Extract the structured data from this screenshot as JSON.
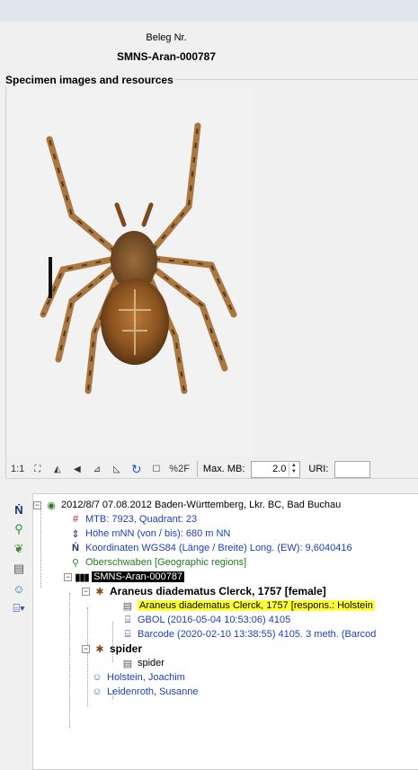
{
  "header": {
    "beleg_label": "Beleg Nr.",
    "beleg_value": "SMNS-Aran-000787"
  },
  "specimen": {
    "group_title": "Specimen images and resources"
  },
  "image_toolbar": {
    "btn_1to1": "1:1",
    "btn_percent": "%2F",
    "maxmb_label": "Max. MB:",
    "maxmb_value": "2.0",
    "uri_label": "URI:",
    "uri_value": ""
  },
  "tree": {
    "event": "2012/8/7 07.08.2012 Baden-Württemberg, Lkr. BC,  Bad Buchau",
    "mtb": "MTB: 7923, Quadrant: 23",
    "hoehe": "Höhe mNN (von / bis): 680 m NN",
    "koord": "Koordinaten WGS84 (Länge / Breite) Long. (EW): 9,6040416",
    "region": "Oberschwaben [Geographic regions]",
    "specimen": "SMNS-Aran-000787",
    "taxon": "Araneus diadematus Clerck, 1757 [female]",
    "ident": "Araneus diadematus Clerck, 1757  [respons.: Holstein",
    "gbol": "GBOL (2016-05-04 10:53:06) 4105",
    "barcode": "Barcode (2020-02-10 13:38:55) 4105. 3 meth. (Barcod",
    "spider_unit": "spider",
    "spider_ident": "spider",
    "collector1": "Holstein, Joachim",
    "collector2": "Leidenroth, Susanne"
  },
  "colors": {
    "highlight": "#ffff33",
    "selected": "#000000",
    "link_blue": "#1a3fbf",
    "geo_green": "#1f7a1f"
  }
}
